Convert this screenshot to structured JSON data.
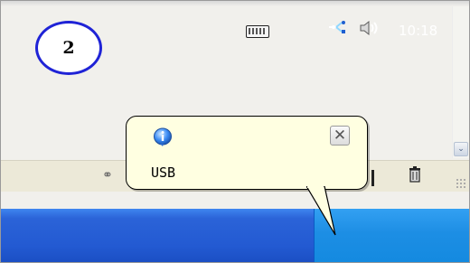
{
  "callout": {
    "step_number": "2"
  },
  "balloon": {
    "message": "USB",
    "icon": "info-icon",
    "close_icon": "close-icon",
    "close_glyph": "✕"
  },
  "taskbar": {
    "clock": "10:18",
    "tray_icons": [
      "keyboard-icon",
      "usb-tray-icon",
      "speaker-icon"
    ]
  },
  "window": {
    "scroll_down_glyph": "⌄",
    "statusbar_icons": [
      "chain-icon",
      "trash-icon"
    ]
  },
  "colors": {
    "taskbar": "#235ad2",
    "tray": "#1d8ee4",
    "balloon_bg": "#ffffe1",
    "callout_ring": "#1f23d6"
  }
}
